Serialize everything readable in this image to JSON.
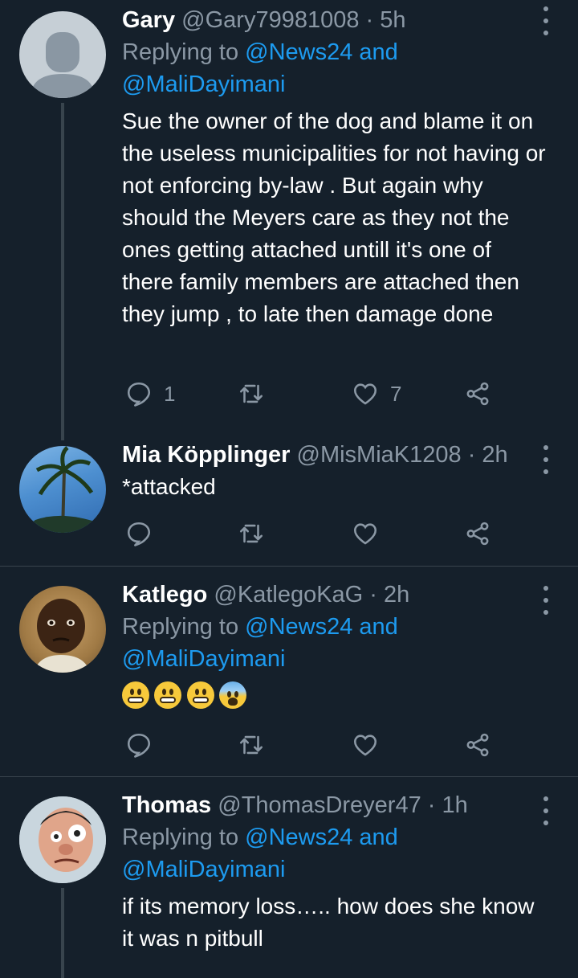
{
  "tweets": [
    {
      "name": "Gary",
      "handle": "@Gary79981008",
      "time": "· 5h",
      "replying_prefix": "Replying to ",
      "replying_to_1": "@News24 and",
      "replying_to_2": "@MaliDayimani",
      "text": "Sue the owner of the dog and blame it on the useless municipalities for not having or not enforcing by-law . But again why should the Meyers care as they not the ones getting attached untill it's one of there family members are attached  then they jump , to late then damage done",
      "reply_count": "1",
      "retweet_count": "",
      "like_count": "7"
    },
    {
      "name": "Mia Köpplinger",
      "handle": "@MisMiaK1208",
      "time": "· 2h",
      "text": "*attacked",
      "reply_count": "",
      "retweet_count": "",
      "like_count": ""
    },
    {
      "name": "Katlego",
      "handle": "@KatlegoKaG",
      "time": "· 2h",
      "replying_prefix": "Replying to ",
      "replying_to_1": "@News24 and",
      "replying_to_2": "@MaliDayimani",
      "emojis": [
        "grimacing-face",
        "grimacing-face",
        "grimacing-face",
        "anxious-face-with-sweat"
      ],
      "reply_count": "",
      "retweet_count": "",
      "like_count": ""
    },
    {
      "name": "Thomas",
      "handle": "@ThomasDreyer47",
      "time": "· 1h",
      "replying_prefix": "Replying to ",
      "replying_to_1": "@News24 and",
      "replying_to_2": "@MaliDayimani",
      "text": "if its memory loss….. how does she know it was n pitbull"
    }
  ],
  "colors": {
    "background": "#15202b",
    "accent_link": "#1d9bf0",
    "muted": "#8b98a5",
    "divider": "#38444d"
  }
}
